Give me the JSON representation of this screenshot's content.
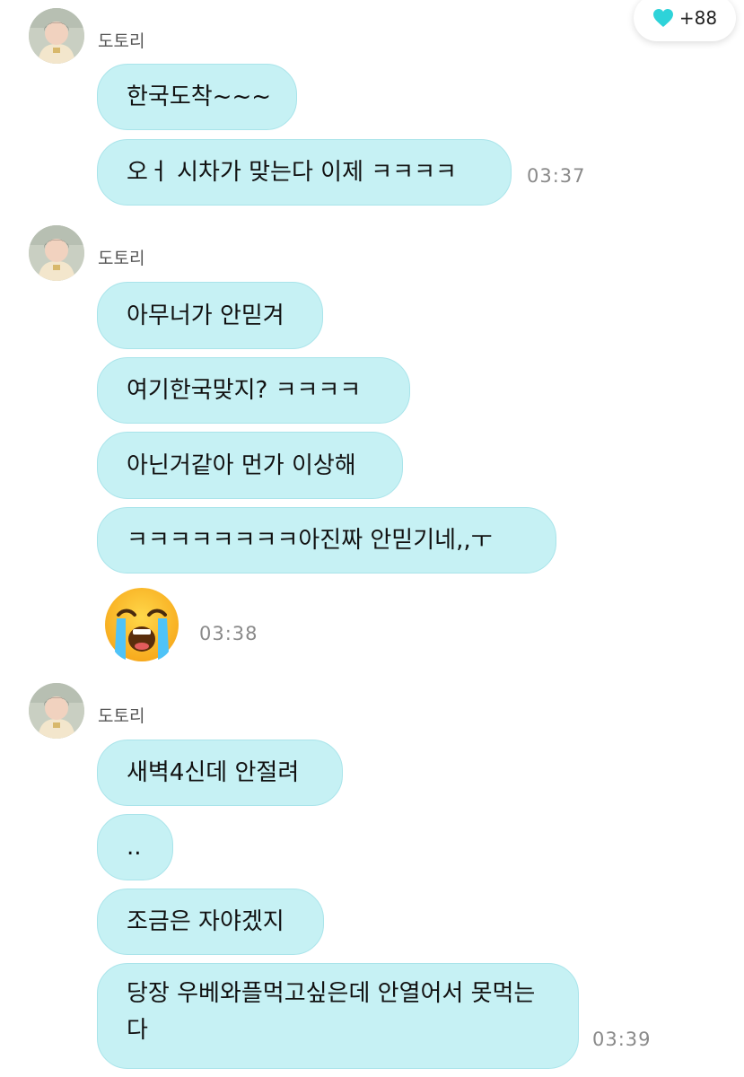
{
  "badge": {
    "icon": "heart-icon",
    "count": "+88",
    "color": "#2ed3d9"
  },
  "colors": {
    "bubble": "#c6f1f4",
    "bubble_border": "#a9e4ea",
    "time": "#8a8a8a"
  },
  "groups": [
    {
      "sender": "도토리",
      "messages": [
        {
          "text": "한국도착~~~"
        },
        {
          "text": "오ㅓ  시차가 맞는다 이제 ㅋㅋㅋㅋ"
        }
      ],
      "time": "03:37"
    },
    {
      "sender": "도토리",
      "messages": [
        {
          "text": "아무너가 안믿겨"
        },
        {
          "text": "여기한국맞지? ㅋㅋㅋㅋ"
        },
        {
          "text": "아닌거같아 먼가 이상해"
        },
        {
          "text": "ㅋㅋㅋㅋㅋㅋㅋㅋ아진짜 안믿기네,,ㅜ"
        }
      ],
      "emoji": "loudly-crying-face-emoji",
      "time": "03:38"
    },
    {
      "sender": "도토리",
      "messages": [
        {
          "text": "새벽4신데 안절려"
        },
        {
          "text": ".."
        },
        {
          "text": "조금은 자야겠지"
        },
        {
          "text": "당장 우베와플먹고싶은데 안열어서 못먹는다"
        }
      ],
      "time": "03:39"
    }
  ]
}
